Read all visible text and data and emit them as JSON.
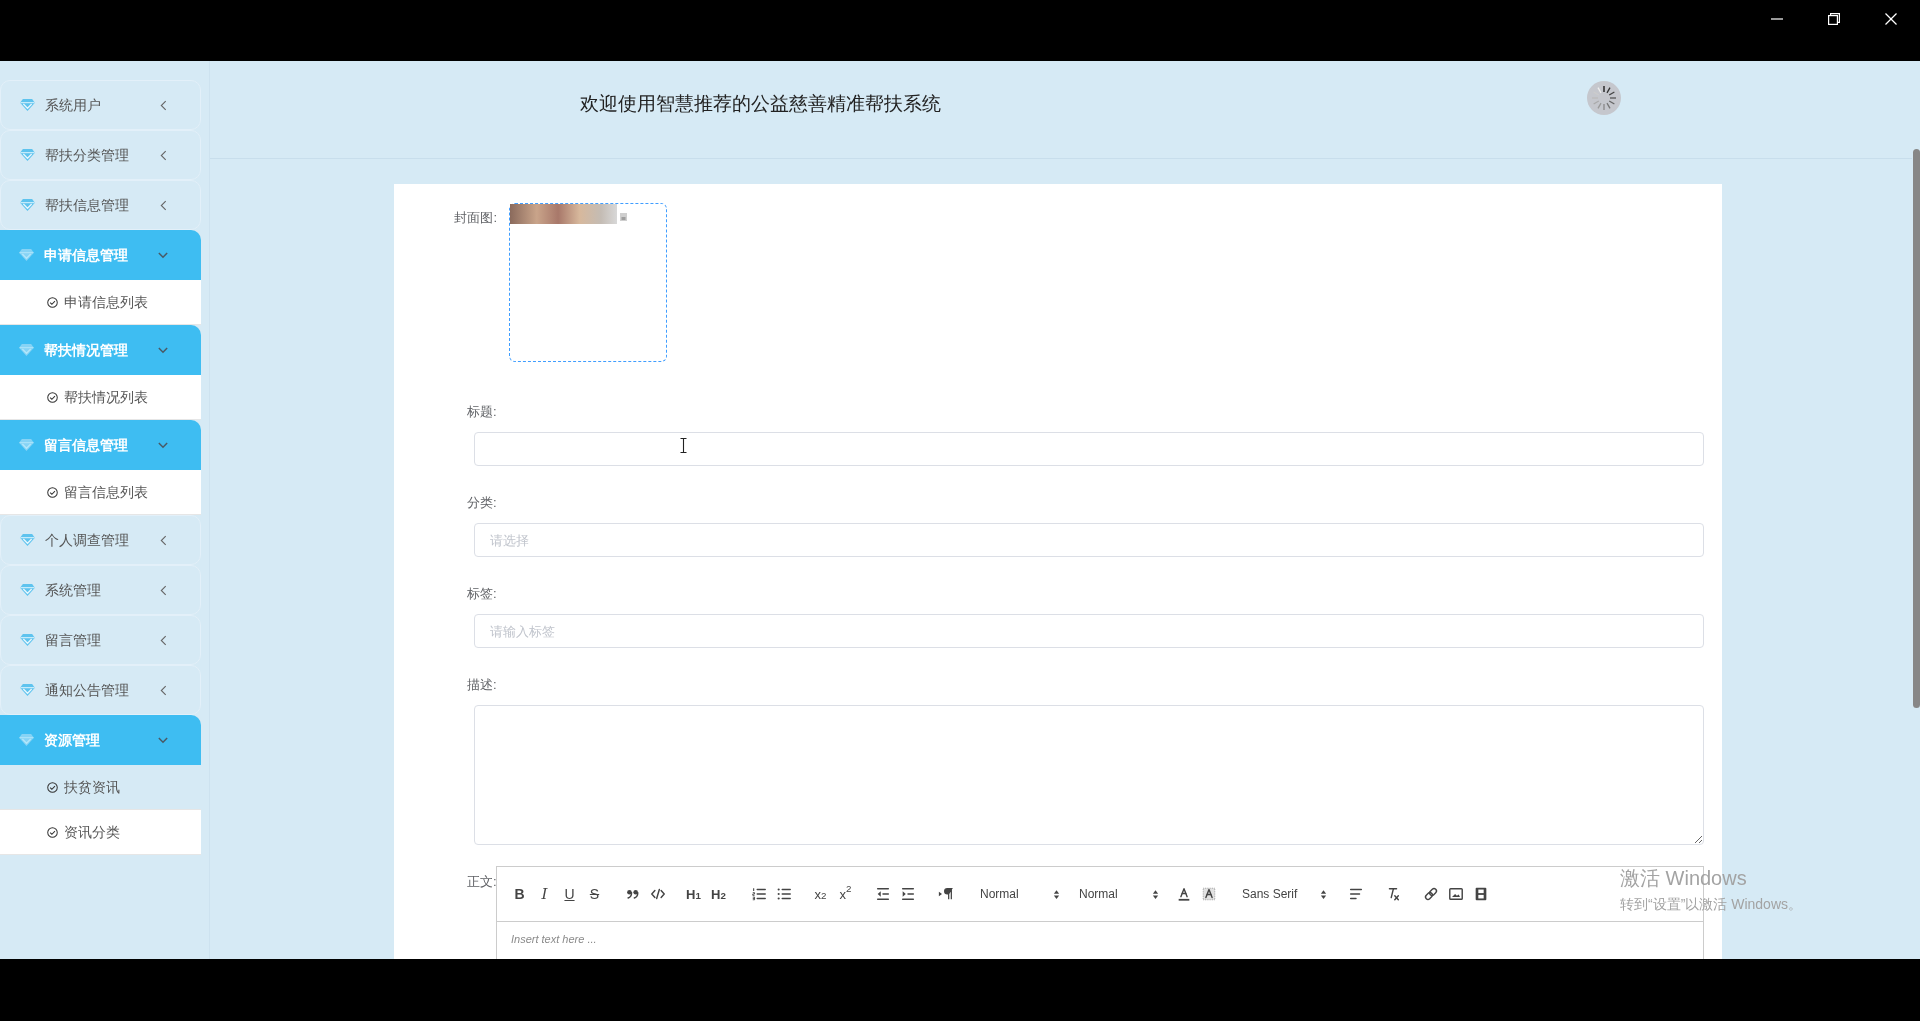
{
  "sidebar": {
    "items": [
      {
        "label": "系统用户",
        "expanded": false
      },
      {
        "label": "帮扶分类管理",
        "expanded": false
      },
      {
        "label": "帮扶信息管理",
        "expanded": false
      },
      {
        "label": "申请信息管理",
        "expanded": true,
        "children": [
          {
            "label": "申请信息列表",
            "selected": false
          }
        ]
      },
      {
        "label": "帮扶情况管理",
        "expanded": true,
        "children": [
          {
            "label": "帮扶情况列表",
            "selected": false
          }
        ]
      },
      {
        "label": "留言信息管理",
        "expanded": true,
        "children": [
          {
            "label": "留言信息列表",
            "selected": false
          }
        ]
      },
      {
        "label": "个人调查管理",
        "expanded": false
      },
      {
        "label": "系统管理",
        "expanded": false
      },
      {
        "label": "留言管理",
        "expanded": false
      },
      {
        "label": "通知公告管理",
        "expanded": false
      },
      {
        "label": "资源管理",
        "expanded": true,
        "children": [
          {
            "label": "扶贫资讯",
            "selected": true
          },
          {
            "label": "资讯分类",
            "selected": false
          }
        ]
      }
    ]
  },
  "header": {
    "title": "欢迎使用智慧推荐的公益慈善精准帮扶系统"
  },
  "form": {
    "fields": [
      {
        "kind": "upload",
        "label": "封面图:"
      },
      {
        "kind": "input",
        "label": "标题:"
      },
      {
        "kind": "select",
        "label": "分类:",
        "placeholder": "请选择"
      },
      {
        "kind": "input",
        "label": "标签:",
        "placeholder": "请输入标签"
      },
      {
        "kind": "textarea",
        "label": "描述:"
      },
      {
        "kind": "editor",
        "label": "正文:",
        "placeholder": "Insert text here ...",
        "toolbar": {
          "format_buttons": [
            "B",
            "I",
            "U",
            "S"
          ],
          "heading_buttons": [
            "H$_{1}$",
            "H$_{2}$"
          ],
          "script_buttons": [
            "x$_{2}$",
            "x$^{2}$"
          ],
          "pickers": [
            "Normal",
            "Normal",
            "Sans Serif"
          ]
        }
      }
    ]
  },
  "activation_notice": {
    "title": "激活 Windows",
    "text": "转到“设置”以激活 Windows。"
  }
}
